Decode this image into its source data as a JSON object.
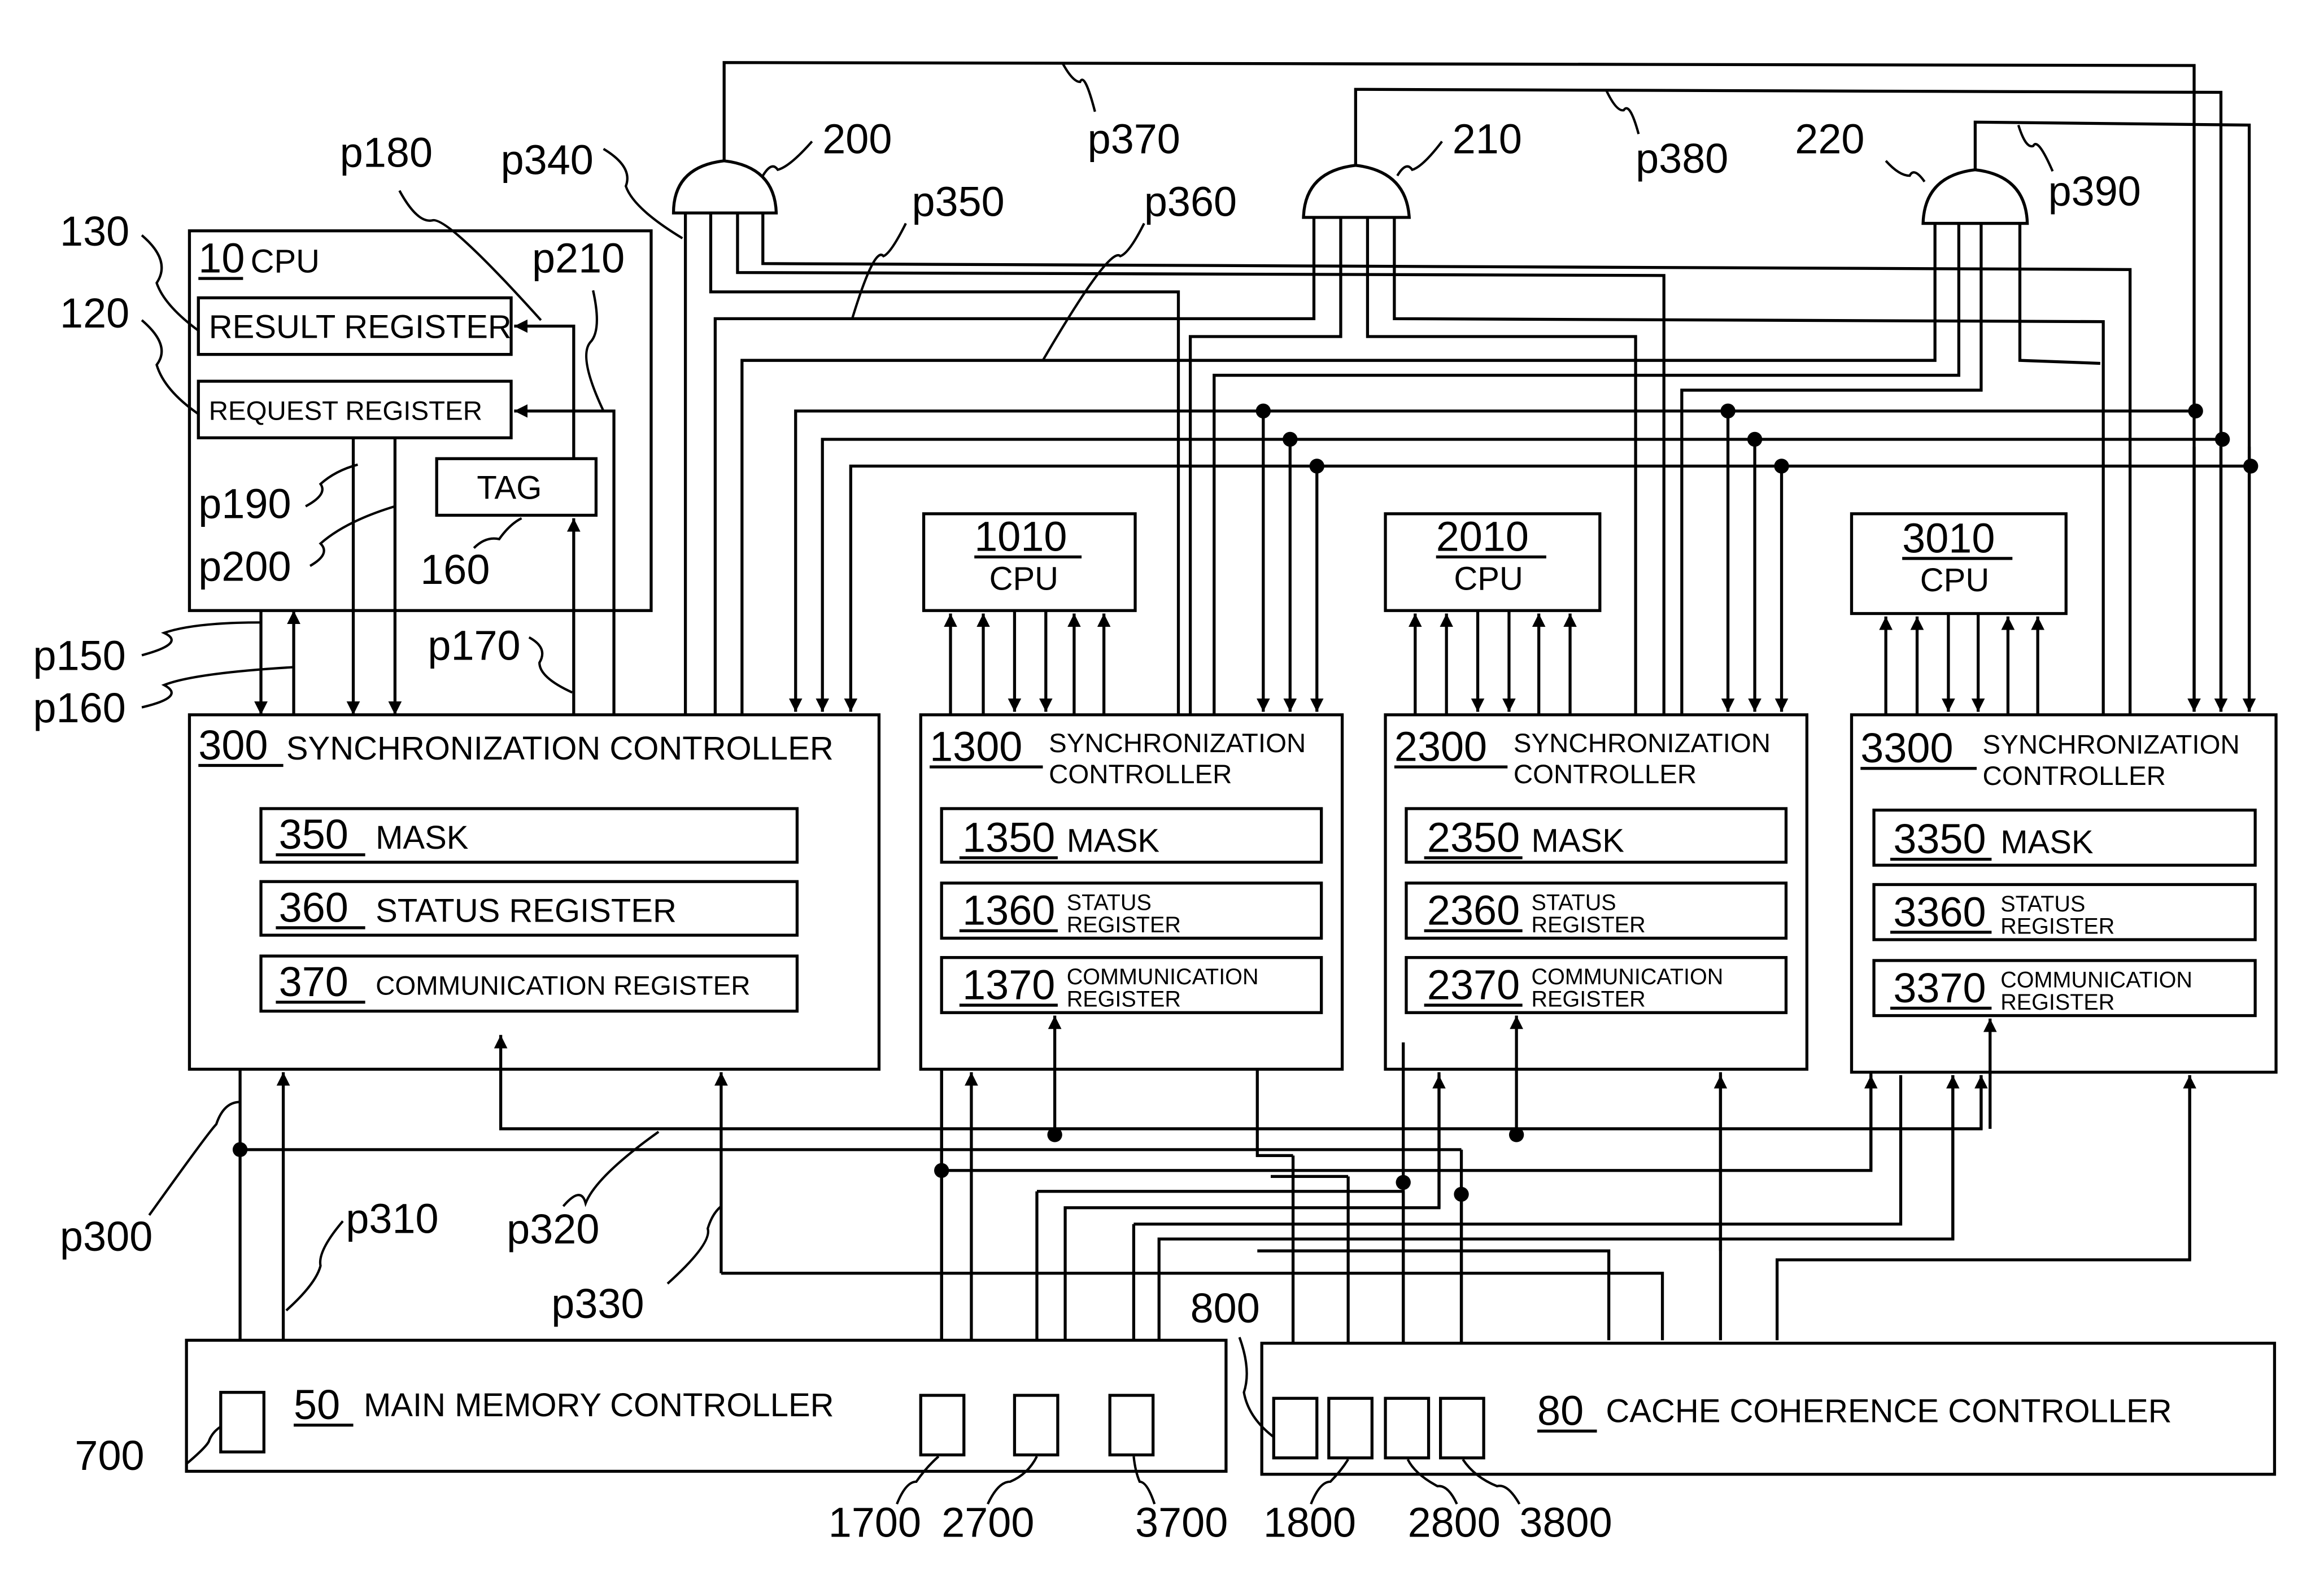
{
  "cpu0": {
    "ref": "10",
    "title": "CPU",
    "result_register": "RESULT REGISTER",
    "request_register": "REQUEST REGISTER",
    "tag": "TAG",
    "ref_result": "130",
    "ref_request": "120",
    "ref_tag": "160"
  },
  "sync0": {
    "ref": "300",
    "title": "SYNCHRONIZATION CONTROLLER",
    "mask_ref": "350",
    "mask": "MASK",
    "status_ref": "360",
    "status": "STATUS REGISTER",
    "comm_ref": "370",
    "comm": "COMMUNICATION REGISTER"
  },
  "nodes": [
    {
      "cpu_ref": "1010",
      "cpu": "CPU",
      "sync_ref": "1300",
      "sync_l1": "SYNCHRONIZATION",
      "sync_l2": "CONTROLLER",
      "mask_ref": "1350",
      "mask": "MASK",
      "status_ref": "1360",
      "status_l1": "STATUS",
      "status_l2": "REGISTER",
      "comm_ref": "1370",
      "comm_l1": "COMMUNICATION",
      "comm_l2": "REGISTER"
    },
    {
      "cpu_ref": "2010",
      "cpu": "CPU",
      "sync_ref": "2300",
      "sync_l1": "SYNCHRONIZATION",
      "sync_l2": "CONTROLLER",
      "mask_ref": "2350",
      "mask": "MASK",
      "status_ref": "2360",
      "status_l1": "STATUS",
      "status_l2": "REGISTER",
      "comm_ref": "2370",
      "comm_l1": "COMMUNICATION",
      "comm_l2": "REGISTER"
    },
    {
      "cpu_ref": "3010",
      "cpu": "CPU",
      "sync_ref": "3300",
      "sync_l1": "SYNCHRONIZATION",
      "sync_l2": "CONTROLLER",
      "mask_ref": "3350",
      "mask": "MASK",
      "status_ref": "3360",
      "status_l1": "STATUS",
      "status_l2": "REGISTER",
      "comm_ref": "3370",
      "comm_l1": "COMMUNICATION",
      "comm_l2": "REGISTER"
    }
  ],
  "gates": [
    "200",
    "210",
    "220"
  ],
  "memory": {
    "ref": "50",
    "title": "MAIN MEMORY CONTROLLER",
    "ports": [
      "700",
      "1700",
      "2700",
      "3700"
    ]
  },
  "cache": {
    "ref": "80",
    "title": "CACHE COHERENCE CONTROLLER",
    "ports": [
      "800",
      "1800",
      "2800",
      "3800"
    ]
  },
  "paths": {
    "p150": "p150",
    "p160": "p160",
    "p170": "p170",
    "p180": "p180",
    "p190": "p190",
    "p200": "p200",
    "p210": "p210",
    "p300": "p300",
    "p310": "p310",
    "p320": "p320",
    "p330": "p330",
    "p340": "p340",
    "p350": "p350",
    "p360": "p360",
    "p370": "p370",
    "p380": "p380",
    "p390": "p390"
  }
}
